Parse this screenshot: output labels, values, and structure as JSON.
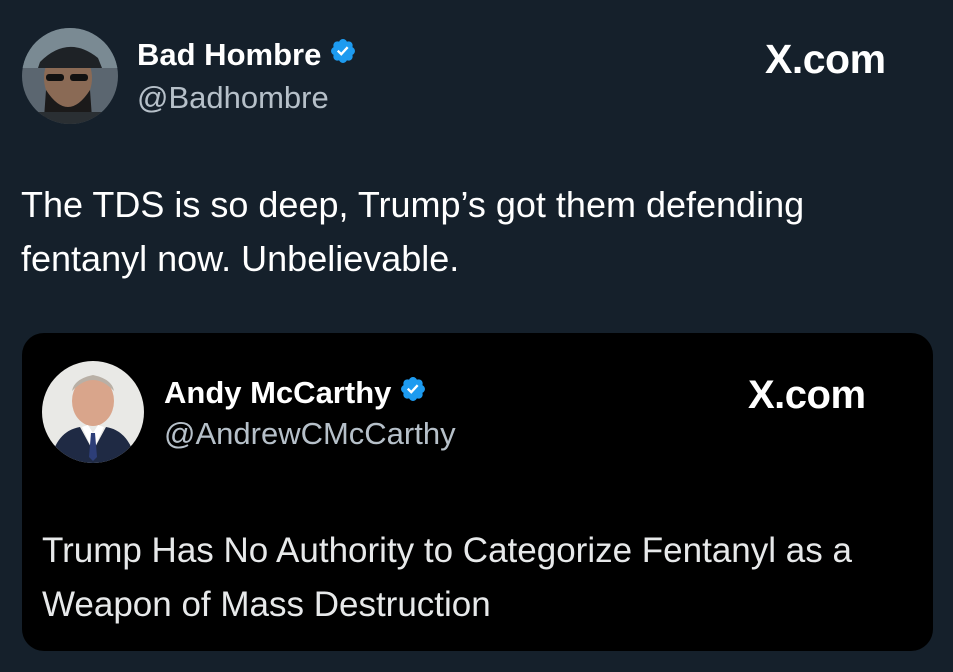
{
  "post": {
    "author": {
      "display_name": "Bad Hombre",
      "handle": "@Badhombre",
      "verified": true,
      "avatar_icon": "profile-photo-man-cap-sunglasses"
    },
    "brand": "X.com",
    "text": "The TDS is so deep, Trump’s got them defending fentanyl now. Unbelievable."
  },
  "quote": {
    "author": {
      "display_name": "Andy McCarthy",
      "handle": "@AndrewCMcCarthy",
      "verified": true,
      "avatar_icon": "profile-photo-man-suit-tie"
    },
    "brand": "X.com",
    "text": "Trump Has No Authority to Categorize Fentanyl as a Weapon of Mass Destruction"
  },
  "colors": {
    "background": "#15202b",
    "quote_background": "#000000",
    "verified_badge": "#1d9bf0",
    "handle_text": "#b6c0c9"
  }
}
